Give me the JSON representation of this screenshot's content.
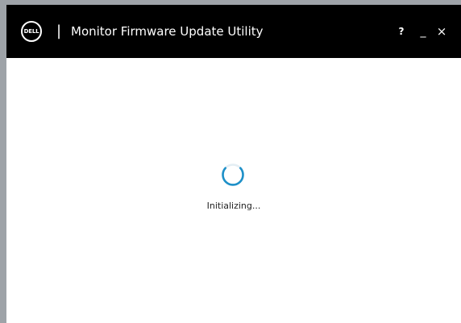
{
  "window": {
    "logo_text": "DELL",
    "title_separator": "|",
    "title": "Monitor Firmware Update Utility",
    "controls": {
      "help": "?",
      "minimize": "_",
      "close": "×"
    }
  },
  "main": {
    "status_text": "Initializing...",
    "spinner_icon": "loading-spinner-icon"
  },
  "colors": {
    "titlebar_bg": "#000000",
    "content_bg": "#ffffff",
    "spinner_accent": "#1e90c8",
    "desktop_bg": "#9ea3a8"
  }
}
